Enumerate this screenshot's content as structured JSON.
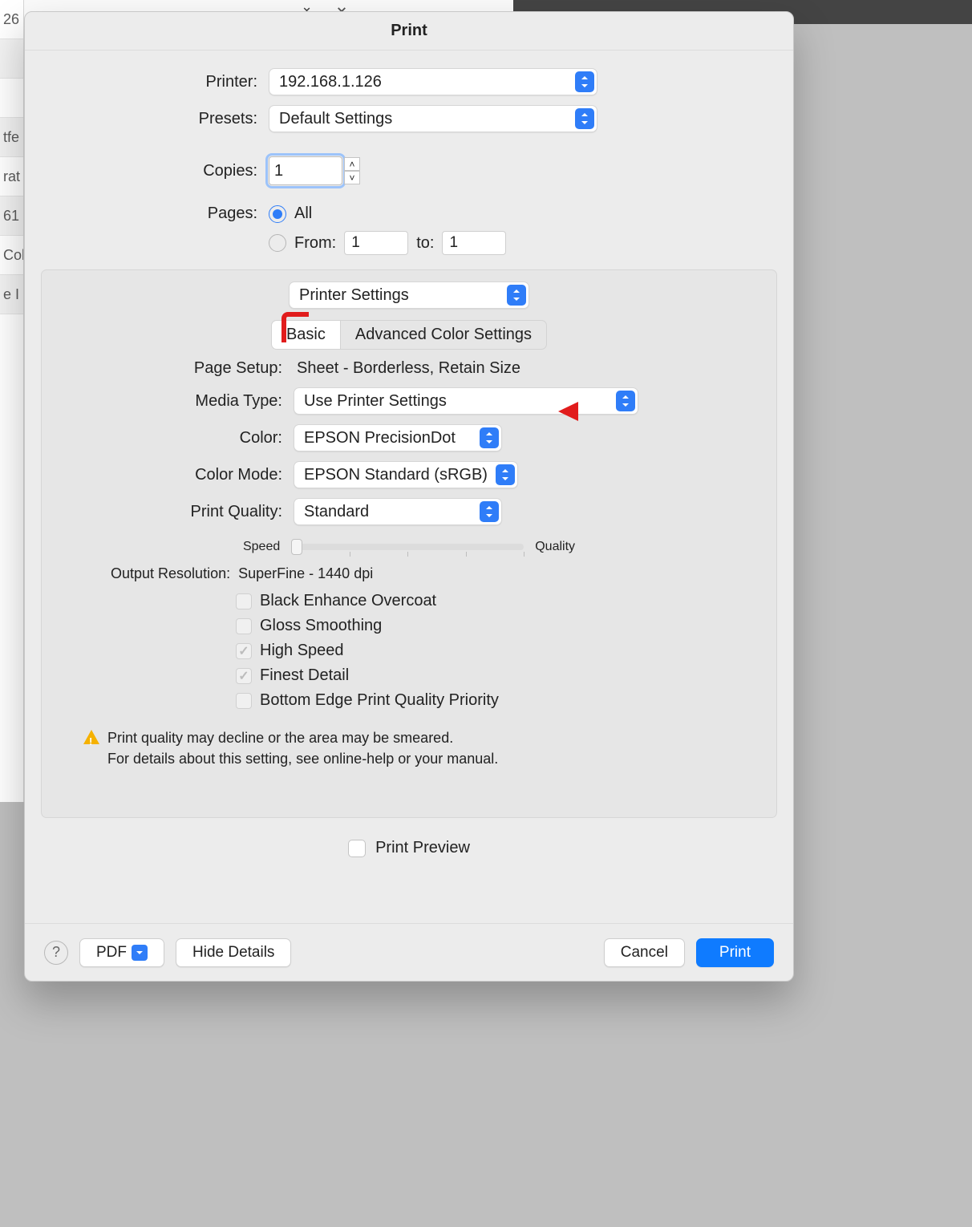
{
  "background_rows": [
    "26",
    "",
    "",
    "tfe",
    "rat",
    "61",
    "Col",
    "e I"
  ],
  "dialog": {
    "title": "Print",
    "printer": {
      "label": "Printer:",
      "value": "192.168.1.126"
    },
    "presets": {
      "label": "Presets:",
      "value": "Default Settings"
    },
    "copies": {
      "label": "Copies:",
      "value": "1"
    },
    "pages": {
      "label": "Pages:",
      "all_label": "All",
      "from_label": "From:",
      "to_label": "to:",
      "from_value": "1",
      "to_value": "1",
      "selected": "all"
    },
    "section_select": "Printer Settings",
    "tabs": {
      "basic": "Basic",
      "advanced": "Advanced Color Settings",
      "active": "basic"
    },
    "page_setup": {
      "label": "Page Setup:",
      "value": "Sheet - Borderless, Retain Size"
    },
    "media_type": {
      "label": "Media Type:",
      "value": "Use Printer Settings"
    },
    "color": {
      "label": "Color:",
      "value": "EPSON PrecisionDot"
    },
    "color_mode": {
      "label": "Color Mode:",
      "value": "EPSON Standard (sRGB)"
    },
    "print_quality": {
      "label": "Print Quality:",
      "value": "Standard"
    },
    "slider": {
      "left": "Speed",
      "right": "Quality"
    },
    "output_resolution": {
      "label": "Output Resolution:",
      "value": "SuperFine - 1440 dpi"
    },
    "checks": [
      {
        "label": "Black Enhance Overcoat",
        "checked": false
      },
      {
        "label": "Gloss Smoothing",
        "checked": false
      },
      {
        "label": "High Speed",
        "checked": true
      },
      {
        "label": "Finest Detail",
        "checked": true
      },
      {
        "label": "Bottom Edge Print Quality Priority",
        "checked": false
      }
    ],
    "warning_line1": "Print quality may decline or the area may be smeared.",
    "warning_line2": "For details about this setting, see online-help or your manual.",
    "print_preview": "Print Preview",
    "footer": {
      "pdf": "PDF",
      "hide": "Hide Details",
      "cancel": "Cancel",
      "print": "Print"
    }
  }
}
